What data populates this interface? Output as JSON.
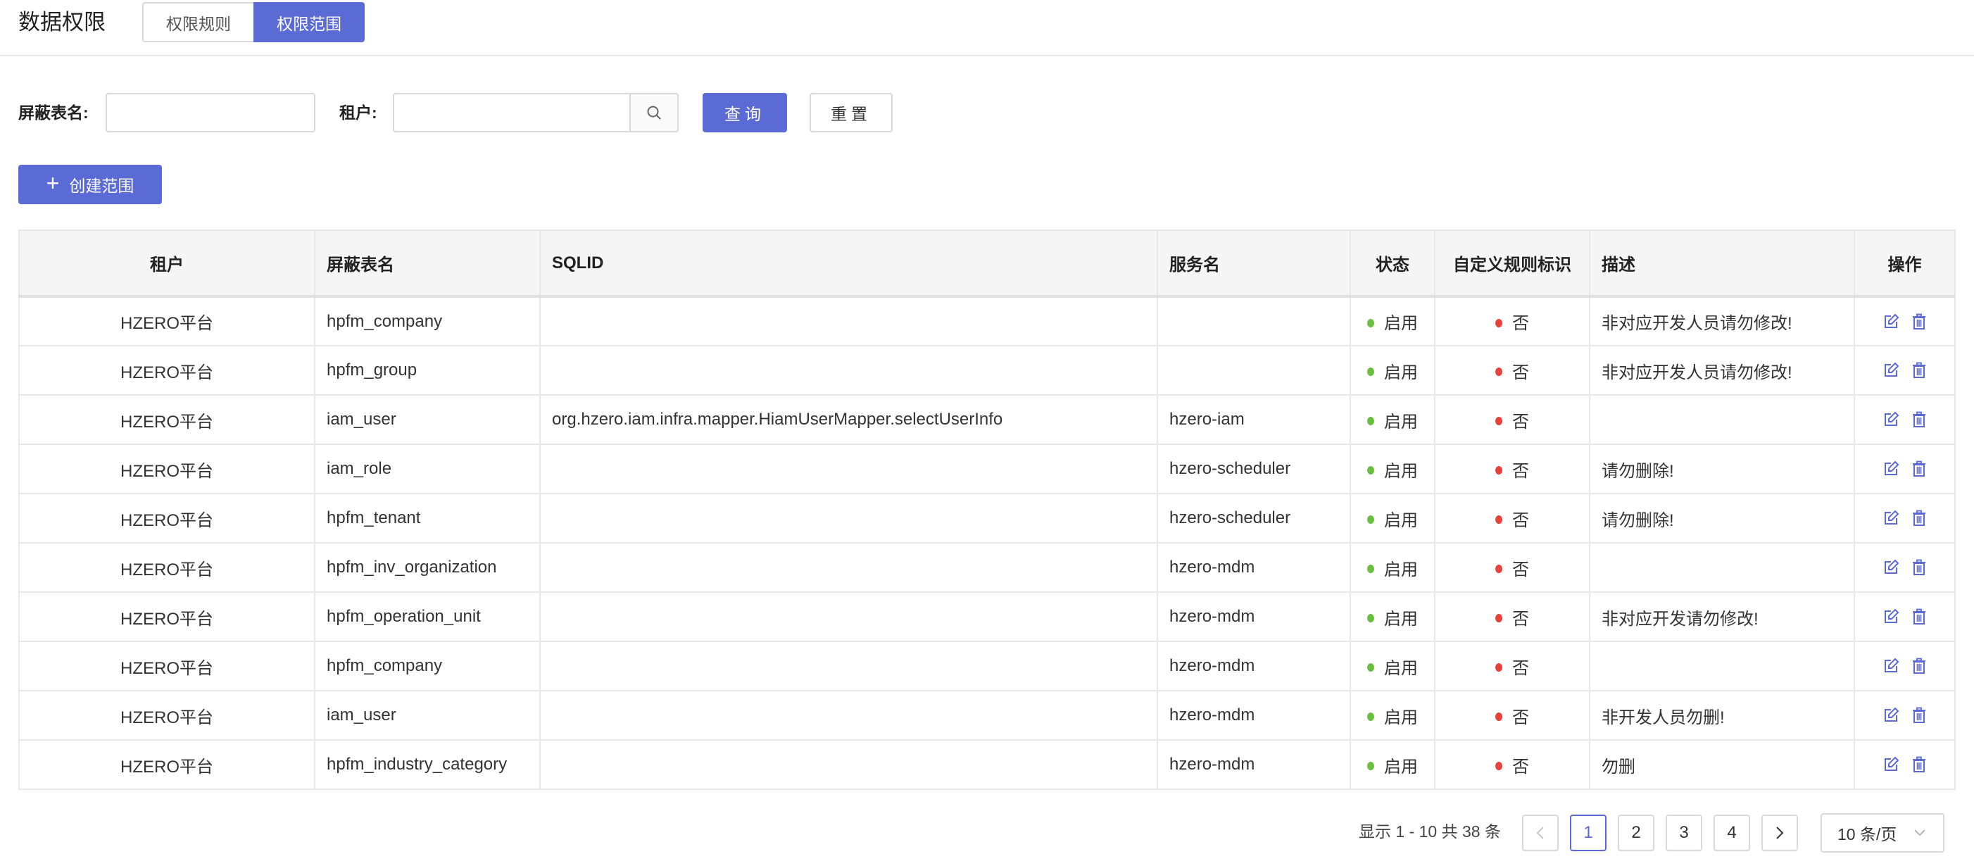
{
  "header": {
    "title": "数据权限",
    "tabs": [
      {
        "label": "权限规则",
        "active": false
      },
      {
        "label": "权限范围",
        "active": true
      }
    ]
  },
  "filters": {
    "table_name_label": "屏蔽表名:",
    "table_name_value": "",
    "tenant_label": "租户:",
    "tenant_value": "",
    "search_icon": "search-icon",
    "query_button": "查询",
    "reset_button": "重置"
  },
  "create_button": {
    "icon": "plus-icon",
    "label": "创建范围"
  },
  "table": {
    "columns": [
      "租户",
      "屏蔽表名",
      "SQLID",
      "服务名",
      "状态",
      "自定义规则标识",
      "描述",
      "操作"
    ],
    "status_color": "#6abf40",
    "custom_color": "#e8413c",
    "rows": [
      {
        "tenant": "HZERO平台",
        "table_name": "hpfm_company",
        "sqlid": "",
        "service": "",
        "status": "启用",
        "custom": "否",
        "desc": "非对应开发人员请勿修改!"
      },
      {
        "tenant": "HZERO平台",
        "table_name": "hpfm_group",
        "sqlid": "",
        "service": "",
        "status": "启用",
        "custom": "否",
        "desc": "非对应开发人员请勿修改!"
      },
      {
        "tenant": "HZERO平台",
        "table_name": "iam_user",
        "sqlid": "org.hzero.iam.infra.mapper.HiamUserMapper.selectUserInfo",
        "service": "hzero-iam",
        "status": "启用",
        "custom": "否",
        "desc": ""
      },
      {
        "tenant": "HZERO平台",
        "table_name": "iam_role",
        "sqlid": "",
        "service": "hzero-scheduler",
        "status": "启用",
        "custom": "否",
        "desc": "请勿删除!"
      },
      {
        "tenant": "HZERO平台",
        "table_name": "hpfm_tenant",
        "sqlid": "",
        "service": "hzero-scheduler",
        "status": "启用",
        "custom": "否",
        "desc": "请勿删除!"
      },
      {
        "tenant": "HZERO平台",
        "table_name": "hpfm_inv_organization",
        "sqlid": "",
        "service": "hzero-mdm",
        "status": "启用",
        "custom": "否",
        "desc": ""
      },
      {
        "tenant": "HZERO平台",
        "table_name": "hpfm_operation_unit",
        "sqlid": "",
        "service": "hzero-mdm",
        "status": "启用",
        "custom": "否",
        "desc": "非对应开发请勿修改!"
      },
      {
        "tenant": "HZERO平台",
        "table_name": "hpfm_company",
        "sqlid": "",
        "service": "hzero-mdm",
        "status": "启用",
        "custom": "否",
        "desc": ""
      },
      {
        "tenant": "HZERO平台",
        "table_name": "iam_user",
        "sqlid": "",
        "service": "hzero-mdm",
        "status": "启用",
        "custom": "否",
        "desc": "非开发人员勿删!"
      },
      {
        "tenant": "HZERO平台",
        "table_name": "hpfm_industry_category",
        "sqlid": "",
        "service": "hzero-mdm",
        "status": "启用",
        "custom": "否",
        "desc": "勿删"
      }
    ]
  },
  "pagination": {
    "info": "显示 1 - 10 共 38 条",
    "prev": "<",
    "next": ">",
    "pages": [
      "1",
      "2",
      "3",
      "4"
    ],
    "current_page": "1",
    "page_size": "10 条/页"
  },
  "colors": {
    "primary": "#5a6bd6",
    "border": "#e8e8e8",
    "header_bg": "#f5f5f5"
  }
}
